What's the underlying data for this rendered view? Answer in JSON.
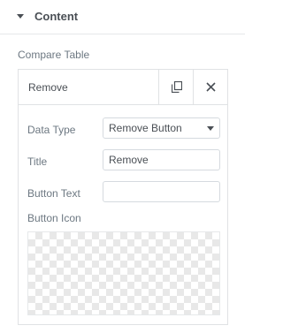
{
  "section": {
    "title": "Content",
    "icon": "caret-down-icon"
  },
  "compare_table": {
    "label": "Compare Table",
    "item": {
      "title": "Remove",
      "actions": {
        "duplicate_icon": "copy-icon",
        "remove_icon": "close-icon"
      },
      "fields": {
        "data_type": {
          "label": "Data Type",
          "value": "Remove Button"
        },
        "title": {
          "label": "Title",
          "value": "Remove"
        },
        "button_text": {
          "label": "Button Text",
          "value": ""
        },
        "button_icon": {
          "label": "Button Icon"
        }
      }
    }
  }
}
